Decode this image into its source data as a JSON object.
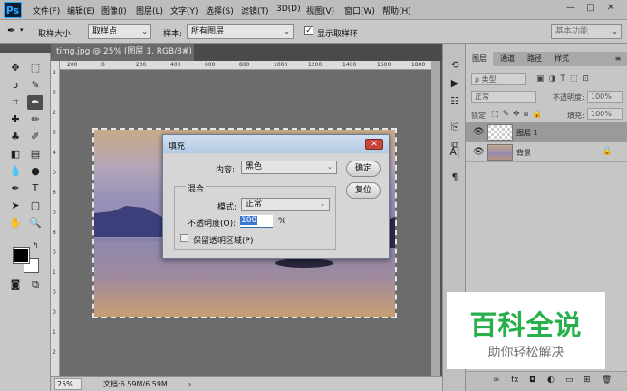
{
  "app": {
    "logo": "Ps",
    "menu": [
      "文件(F)",
      "编辑(E)",
      "图像(I)",
      "图层(L)",
      "文字(Y)",
      "选择(S)",
      "滤镜(T)",
      "3D(D)",
      "视图(V)",
      "窗口(W)",
      "帮助(H)"
    ],
    "window_buttons": [
      "—",
      "□",
      "✕"
    ]
  },
  "options_bar": {
    "sample_size_label": "取样大小:",
    "sample_size_value": "取样点",
    "sample_label": "样本:",
    "sample_value": "所有图层",
    "show_ring_label": "显示取样环",
    "show_ring_checked": true,
    "workspace_value": "基本功能"
  },
  "document": {
    "tab_title": "timg.jpg @ 25% (图层 1, RGB/8#) *",
    "tab_close": "×",
    "ruler_top_ticks": [
      "200",
      "0",
      "200",
      "400",
      "600",
      "800",
      "1000",
      "1200",
      "1400",
      "1600",
      "1800"
    ],
    "ruler_left_ticks": [
      "2",
      "0",
      "2",
      "0",
      "4",
      "0",
      "6",
      "0",
      "8",
      "0",
      "1",
      "0",
      "0",
      "1",
      "2"
    ]
  },
  "statusbar": {
    "zoom": "25%",
    "doc_size": "文档:6.59M/6.59M",
    "arrow": "›"
  },
  "fill_dialog": {
    "title": "填充",
    "close": "✕",
    "contents_label": "内容:",
    "contents_value": "黑色",
    "ok_label": "确定",
    "reset_label": "复位",
    "blending_legend": "混合",
    "mode_label": "模式:",
    "mode_value": "正常",
    "opacity_label": "不透明度(O):",
    "opacity_value": "100",
    "opacity_unit": "%",
    "preserve_label": "保留透明区域(P)",
    "preserve_checked": false
  },
  "layers_panel": {
    "tabs": [
      "图层",
      "通道",
      "路径",
      "样式"
    ],
    "kind_filter": "ρ 类型",
    "blend_mode": "正常",
    "opacity_label": "不透明度:",
    "opacity_value": "100%",
    "lock_label": "锁定:",
    "fill_label": "填充:",
    "fill_value": "100%",
    "layers": [
      {
        "name": "图层 1",
        "selected": true,
        "locked": false
      },
      {
        "name": "背景",
        "selected": false,
        "locked": true
      }
    ],
    "bottom_icons": [
      "∞",
      "fx",
      "◘",
      "◐",
      "▭",
      "⊞",
      "🗑"
    ]
  },
  "watermark": {
    "title": "百科全说",
    "subtitle": "助你轻松解决"
  },
  "colors": {
    "fg": "#000000",
    "bg": "#ffffff",
    "dialog_close": "#c8453a",
    "selection_blue": "#3a78d4",
    "watermark_green": "#27b04b"
  }
}
